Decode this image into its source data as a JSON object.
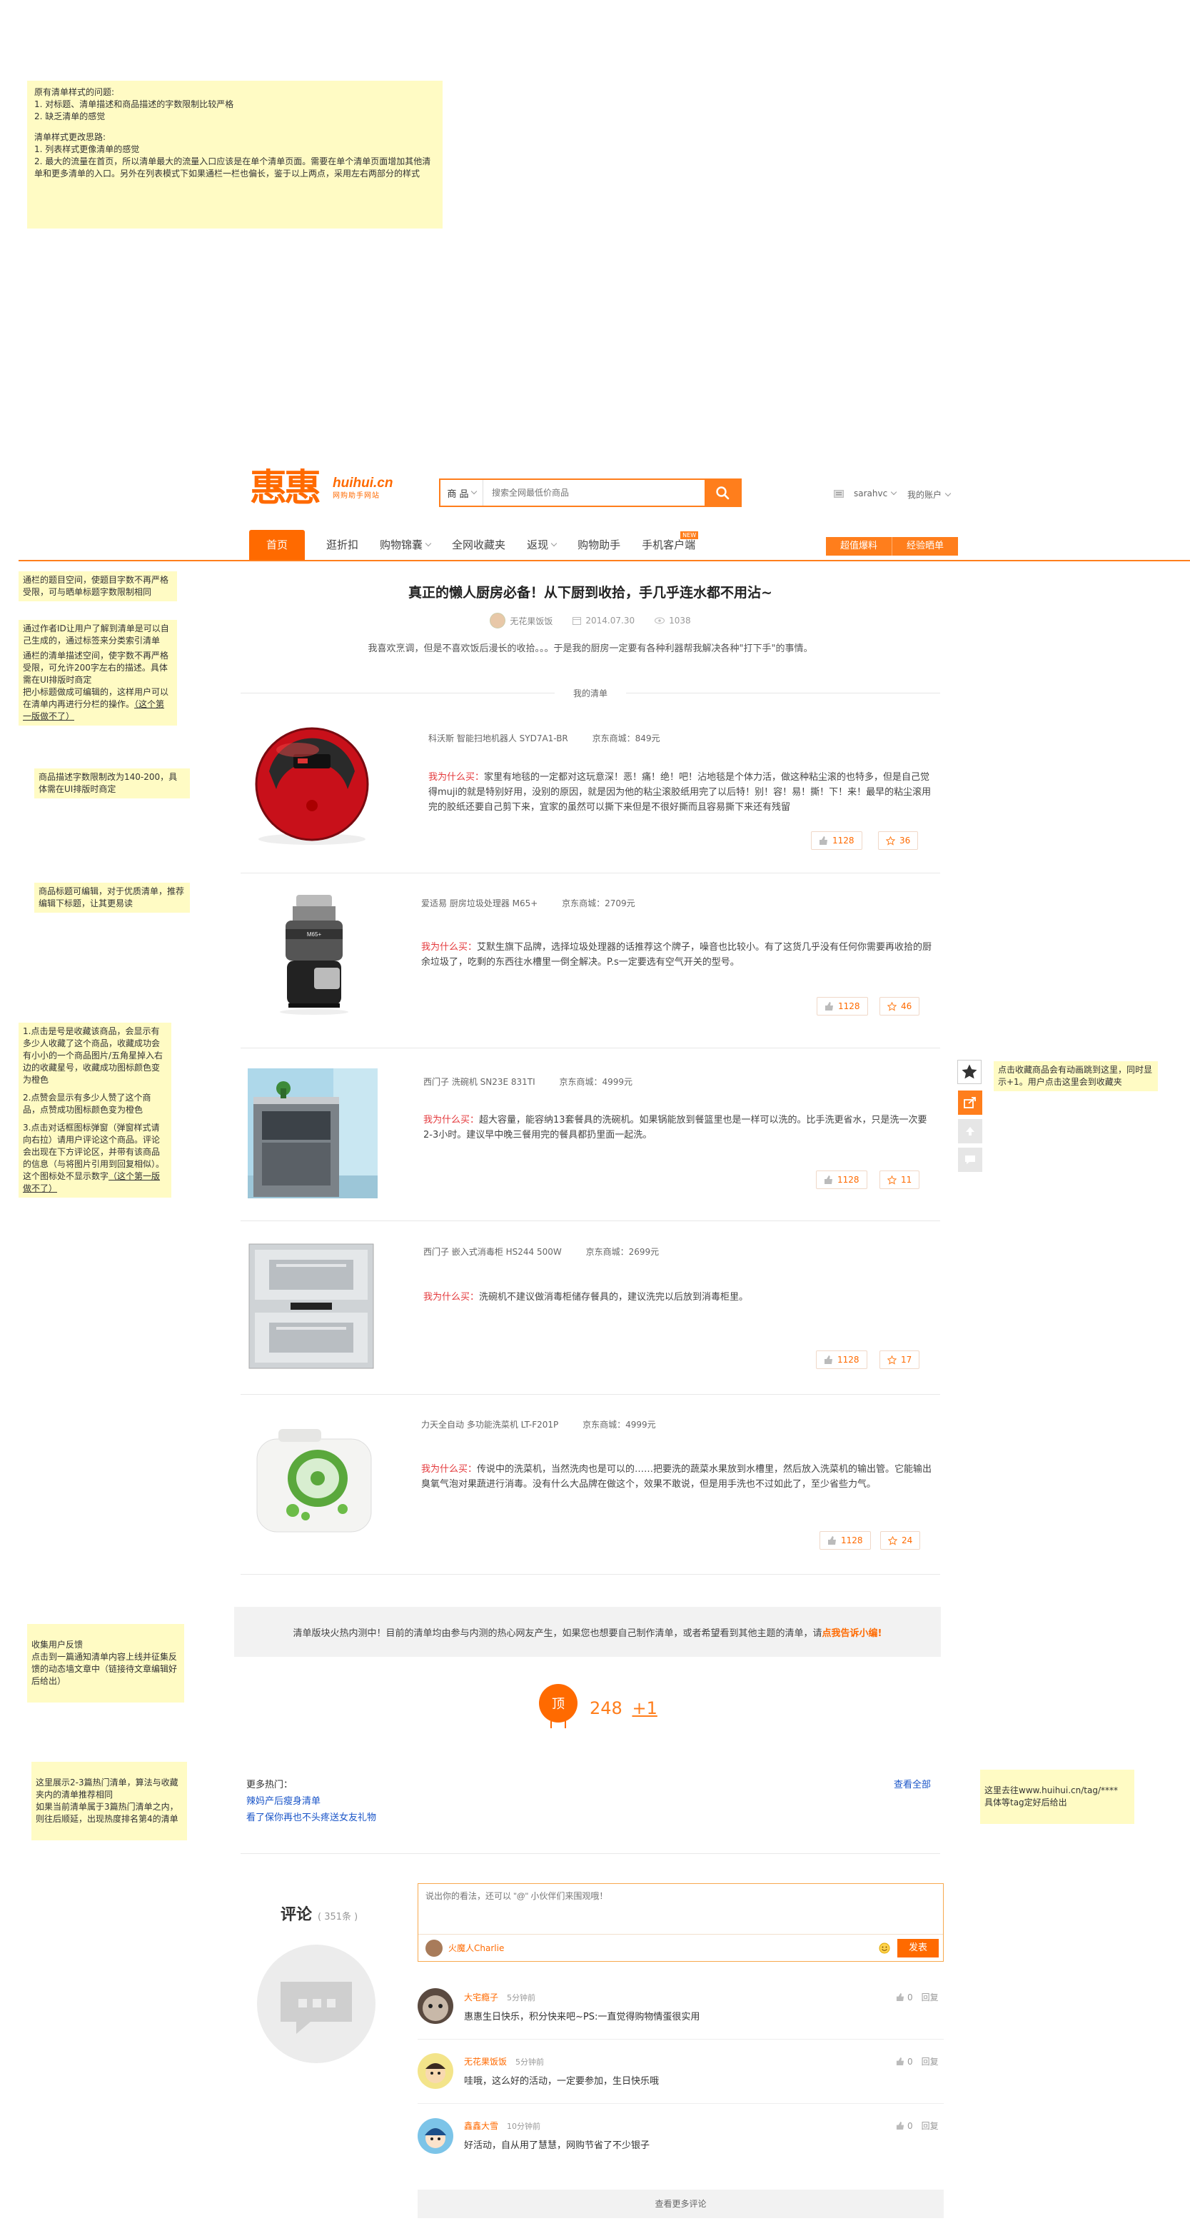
{
  "notes": {
    "top": [
      "原有清单样式的问题:",
      "1. 对标题、清单描述和商品描述的字数限制比较严格",
      "2. 缺乏清单的感觉",
      "",
      "清单样式更改思路:",
      "1. 列表样式更像清单的感觉",
      "2. 最大的流量在首页，所以清单最大的流量入口应该是在单个清单页面。需要在单个清单页面增加其他清单和更多清单的入口。另外在列表模式下如果通栏一栏也偏长，鉴于以上两点，采用左右两部分的样式"
    ],
    "title": "通栏的题目空间，使题目字数不再严格受限，可与晒单标题字数限制相同",
    "author_lines": [
      "通过作者ID让用户了解到清单是可以自己生成的，通过标签来分类索引清单",
      "通栏的清单描述空间，使字数不再严格受限，可允许200字左右的描述。具体需在UI排版时商定",
      "把小标题做成可编辑的，这样用户可以在清单内再进行分栏的操作。"
    ],
    "author_link": "（这个第一版做不了）",
    "desc": "商品描述字数限制改为140-200，具体需在UI排版时商定",
    "product_title": "商品标题可编辑，对于优质清单，推荐编辑下标题，让其更易读",
    "interact_1": "1.点击是号是收藏该商品，会显示有多少人收藏了这个商品，收藏成功会有小小的一个商品图片/五角星掉入右边的收藏星号，收藏成功图标颜色变为橙色",
    "interact_2": "2.点赞会显示有多少人赞了这个商品，点赞成功图标颜色变为橙色",
    "interact_3": "3.点击对话框图标弹窗（弹窗样式请向右拉）请用户评论这个商品。评论会出现在下方评论区，并带有该商品的信息（与将图片引用到回复相似）。这个图标处不显示数字",
    "interact_link": "（这个第一版做不了）",
    "side_hint": "点击收藏商品会有动画跳到这里，同时显示+1。用户点击这里会到收藏夹",
    "feedback": "收集用户反馈\n点击到一篇通知清单内容上线并征集反馈的动态墙文章中（链接待文章编辑好后给出）",
    "hot": "这里展示2-3篇热门清单，算法与收藏夹内的清单推荐相同\n如果当前清单属于3篇热门清单之内，则往后顺延，出现热度排名第4的清单",
    "tag": "这里去往www.huihui.cn/tag/****\n具体等tag定好后给出"
  },
  "header": {
    "logo_text": "惠惠",
    "logo_site": "huihui.cn",
    "logo_tagline": "网购助手网站",
    "search_category": "商 品",
    "search_placeholder": "搜索全网最低价商品",
    "username": "sarahvc",
    "account": "我的账户"
  },
  "nav": {
    "items": [
      "首页",
      "逛折扣",
      "购物锦囊",
      "全网收藏夹",
      "返现",
      "购物助手",
      "手机客户端"
    ],
    "new_badge": "NEW",
    "btn_hot": "超值爆料",
    "btn_share": "经验晒单"
  },
  "article": {
    "title": "真正的懒人厨房必备！从下厨到收拾，手几乎连水都不用沾~",
    "author": "无花果饭饭",
    "date": "2014.07.30",
    "views": "1038",
    "intro": "我喜欢烹调，但是不喜欢饭后漫长的收拾。。。于是我的厨房一定要有各种利器帮我解决各种\"打下手\"的事情。",
    "section_label": "我的清单"
  },
  "products": [
    {
      "name": "科沃斯  智能扫地机器人  SYD7A1-BR",
      "price": "京东商城：849元",
      "reason_label": "我为什么买：",
      "reason": "家里有地毯的一定都对这玩意深！恶！痛！绝！吧！沾地毯是个体力活，做这种粘尘滚的也特多，但是自己觉得muji的就是特别好用，没别的原因，就是因为他的粘尘滚胶纸用完了以后特！别！容！易！撕！下！来！最早的粘尘滚用完的胶纸还要自己剪下来，宜家的虽然可以撕下来但是不很好撕而且容易撕下来还有残留",
      "likes": "1128",
      "favs": "36"
    },
    {
      "name": "爱适易  厨房垃圾处理器  M65+",
      "price": "京东商城：2709元",
      "reason_label": "我为什么买：",
      "reason": "艾默生旗下品牌，选择垃圾处理器的话推荐这个牌子，噪音也比较小。有了这货几乎没有任何你需要再收拾的厨余垃圾了，吃剩的东西往水槽里一倒全解决。P.s一定要选有空气开关的型号。",
      "likes": "1128",
      "favs": "46"
    },
    {
      "name": "西门子  洗碗机    SN23E  831TI",
      "price": "京东商城：4999元",
      "reason_label": "我为什么买：",
      "reason": "超大容量，能容纳13套餐具的洗碗机。如果锅能放到餐篮里也是一样可以洗的。比手洗更省水，只是洗一次要2-3小时。建议早中晚三餐用完的餐具都扔里面一起洗。",
      "likes": "1128",
      "favs": "11"
    },
    {
      "name": "西门子  嵌入式消毒柜    HS244  500W",
      "price": "京东商城：2699元",
      "reason_label": "我为什么买：",
      "reason": "洗碗机不建议做消毒柜储存餐具的，建议洗完以后放到消毒柜里。",
      "likes": "1128",
      "favs": "17"
    },
    {
      "name": "力天全自动  多功能洗菜机  LT-F201P",
      "price": "京东商城：4999元",
      "reason_label": "我为什么买：",
      "reason": "传说中的洗菜机，当然洗肉也是可以的……把要洗的蔬菜水果放到水槽里，然后放入洗菜机的输出管。它能输出臭氧气泡对果蔬进行消毒。没有什么大品牌在做这个，效果不敢说，但是用手洗也不过如此了，至少省些力气。",
      "likes": "1128",
      "favs": "24"
    }
  ],
  "banner": {
    "text": "清单版块火热内测中！目前的清单均由参与内测的热心网友产生，如果您也想要自己制作清单，或者希望看到其他主题的清单，请",
    "link": "点我告诉小编!"
  },
  "top_vote": {
    "label": "顶",
    "count": "248",
    "plus": "+1"
  },
  "more_hot": {
    "label": "更多热门：",
    "links": [
      "辣妈产后瘦身清单",
      "看了保你再也不头疼送女友礼物"
    ],
    "view_all": "查看全部"
  },
  "comments": {
    "title": "评论",
    "count": "( 351条 )",
    "input_placeholder": "说出你的看法，还可以 \"@\" 小伙伴们来围观哦！",
    "current_user": "火魔人Charlie",
    "submit": "发表",
    "list": [
      {
        "name": "大宅瘾子",
        "time": "5分钟前",
        "text": "惠惠生日快乐，积分快来吧~PS:一直觉得购物情蛋很实用",
        "likes": "0",
        "reply": "回复"
      },
      {
        "name": "无花果饭饭",
        "time": "5分钟前",
        "text": "哇哦，这么好的活动，一定要参加，生日快乐哦",
        "likes": "0",
        "reply": "回复"
      },
      {
        "name": "鑫鑫大雪",
        "time": "10分钟前",
        "text": "好活动，自从用了慧慧，网购节省了不少银子",
        "likes": "0",
        "reply": "回复"
      }
    ],
    "more": "查看更多评论"
  },
  "colors": {
    "brand_orange": "#ff6a00",
    "note_yellow": "#fffbc4",
    "reason_red": "#e4393c"
  }
}
